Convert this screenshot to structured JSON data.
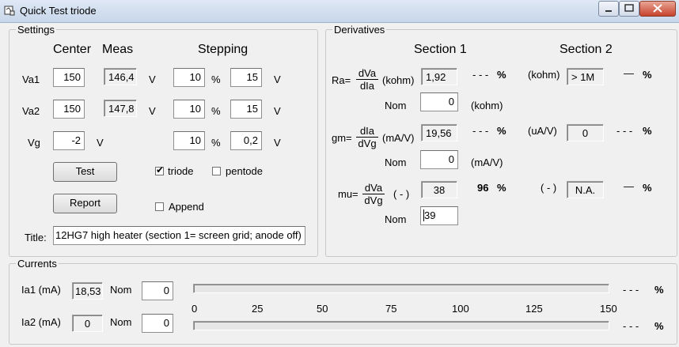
{
  "window": {
    "title": "Quick Test triode"
  },
  "settings": {
    "title": "Settings",
    "col_center": "Center",
    "col_meas": "Meas",
    "col_stepping": "Stepping",
    "rows": [
      {
        "label": "Va1",
        "center": "150",
        "meas": "146,4",
        "unit": "V",
        "step_pct": "10",
        "pct": "%",
        "step_v": "15",
        "step_unit": "V"
      },
      {
        "label": "Va2",
        "center": "150",
        "meas": "147,8",
        "unit": "V",
        "step_pct": "10",
        "pct": "%",
        "step_v": "15",
        "step_unit": "V"
      },
      {
        "label": "Vg",
        "center": "-2",
        "unit": "V",
        "step_pct": "10",
        "pct": "%",
        "step_v": "0,2",
        "step_unit": "V"
      }
    ],
    "test_btn": "Test",
    "report_btn": "Report",
    "triode_label": "triode",
    "triode_checked": true,
    "pentode_label": "pentode",
    "pentode_checked": false,
    "append_label": "Append",
    "append_checked": false,
    "title_label": "Title:",
    "title_value": "12HG7 high heater (section 1= screen grid; anode off)"
  },
  "derivatives": {
    "title": "Derivatives",
    "section1": "Section 1",
    "section2": "Section 2",
    "ra": {
      "prefix": "Ra=",
      "num": "dVa",
      "den": "dIa",
      "unit": "(kohm)",
      "value": "1,92",
      "dev": "- - -",
      "pct": "%",
      "unit2": "(kohm)",
      "value2": "> 1M",
      "dev2": "—",
      "pct2": "%",
      "nom_label": "Nom",
      "nom": "0",
      "nom_unit": "(kohm)"
    },
    "gm": {
      "prefix": "gm=",
      "num": "dIa",
      "den": "dVg",
      "unit": "(mA/V)",
      "value": "19,56",
      "dev": "- - -",
      "pct": "%",
      "unit2": "(uA/V)",
      "value2": "0",
      "dev2": "- - -",
      "pct2": "%",
      "nom_label": "Nom",
      "nom": "0",
      "nom_unit": "(mA/V)"
    },
    "mu": {
      "prefix": "mu=",
      "num": "dVa",
      "den": "dVg",
      "unit": "( - )",
      "value": "38",
      "dev": "96",
      "pct": "%",
      "unit2": "( - )",
      "value2": "N.A.",
      "dev2": "—",
      "pct2": "%",
      "nom_label": "Nom",
      "nom": "39"
    }
  },
  "currents": {
    "title": "Currents",
    "ia1": {
      "label": "Ia1 (mA)",
      "value": "18,53",
      "nom_label": "Nom",
      "nom": "0",
      "dev": "- - -",
      "pct": "%",
      "level": 0
    },
    "ia2": {
      "label": "Ia2 (mA)",
      "value": "0",
      "nom_label": "Nom",
      "nom": "0",
      "dev": "- - -",
      "pct": "%",
      "level": 0
    },
    "scale": [
      "0",
      "25",
      "50",
      "75",
      "100",
      "125",
      "150"
    ]
  }
}
